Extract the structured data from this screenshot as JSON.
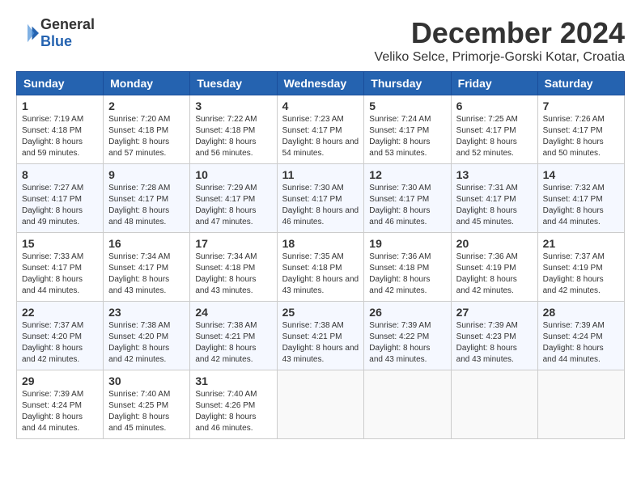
{
  "logo": {
    "general": "General",
    "blue": "Blue"
  },
  "title": "December 2024",
  "location": "Veliko Selce, Primorje-Gorski Kotar, Croatia",
  "days_of_week": [
    "Sunday",
    "Monday",
    "Tuesday",
    "Wednesday",
    "Thursday",
    "Friday",
    "Saturday"
  ],
  "weeks": [
    [
      {
        "day": "1",
        "sunrise": "7:19 AM",
        "sunset": "4:18 PM",
        "daylight": "8 hours and 59 minutes."
      },
      {
        "day": "2",
        "sunrise": "7:20 AM",
        "sunset": "4:18 PM",
        "daylight": "8 hours and 57 minutes."
      },
      {
        "day": "3",
        "sunrise": "7:22 AM",
        "sunset": "4:18 PM",
        "daylight": "8 hours and 56 minutes."
      },
      {
        "day": "4",
        "sunrise": "7:23 AM",
        "sunset": "4:17 PM",
        "daylight": "8 hours and 54 minutes."
      },
      {
        "day": "5",
        "sunrise": "7:24 AM",
        "sunset": "4:17 PM",
        "daylight": "8 hours and 53 minutes."
      },
      {
        "day": "6",
        "sunrise": "7:25 AM",
        "sunset": "4:17 PM",
        "daylight": "8 hours and 52 minutes."
      },
      {
        "day": "7",
        "sunrise": "7:26 AM",
        "sunset": "4:17 PM",
        "daylight": "8 hours and 50 minutes."
      }
    ],
    [
      {
        "day": "8",
        "sunrise": "7:27 AM",
        "sunset": "4:17 PM",
        "daylight": "8 hours and 49 minutes."
      },
      {
        "day": "9",
        "sunrise": "7:28 AM",
        "sunset": "4:17 PM",
        "daylight": "8 hours and 48 minutes."
      },
      {
        "day": "10",
        "sunrise": "7:29 AM",
        "sunset": "4:17 PM",
        "daylight": "8 hours and 47 minutes."
      },
      {
        "day": "11",
        "sunrise": "7:30 AM",
        "sunset": "4:17 PM",
        "daylight": "8 hours and 46 minutes."
      },
      {
        "day": "12",
        "sunrise": "7:30 AM",
        "sunset": "4:17 PM",
        "daylight": "8 hours and 46 minutes."
      },
      {
        "day": "13",
        "sunrise": "7:31 AM",
        "sunset": "4:17 PM",
        "daylight": "8 hours and 45 minutes."
      },
      {
        "day": "14",
        "sunrise": "7:32 AM",
        "sunset": "4:17 PM",
        "daylight": "8 hours and 44 minutes."
      }
    ],
    [
      {
        "day": "15",
        "sunrise": "7:33 AM",
        "sunset": "4:17 PM",
        "daylight": "8 hours and 44 minutes."
      },
      {
        "day": "16",
        "sunrise": "7:34 AM",
        "sunset": "4:17 PM",
        "daylight": "8 hours and 43 minutes."
      },
      {
        "day": "17",
        "sunrise": "7:34 AM",
        "sunset": "4:18 PM",
        "daylight": "8 hours and 43 minutes."
      },
      {
        "day": "18",
        "sunrise": "7:35 AM",
        "sunset": "4:18 PM",
        "daylight": "8 hours and 43 minutes."
      },
      {
        "day": "19",
        "sunrise": "7:36 AM",
        "sunset": "4:18 PM",
        "daylight": "8 hours and 42 minutes."
      },
      {
        "day": "20",
        "sunrise": "7:36 AM",
        "sunset": "4:19 PM",
        "daylight": "8 hours and 42 minutes."
      },
      {
        "day": "21",
        "sunrise": "7:37 AM",
        "sunset": "4:19 PM",
        "daylight": "8 hours and 42 minutes."
      }
    ],
    [
      {
        "day": "22",
        "sunrise": "7:37 AM",
        "sunset": "4:20 PM",
        "daylight": "8 hours and 42 minutes."
      },
      {
        "day": "23",
        "sunrise": "7:38 AM",
        "sunset": "4:20 PM",
        "daylight": "8 hours and 42 minutes."
      },
      {
        "day": "24",
        "sunrise": "7:38 AM",
        "sunset": "4:21 PM",
        "daylight": "8 hours and 42 minutes."
      },
      {
        "day": "25",
        "sunrise": "7:38 AM",
        "sunset": "4:21 PM",
        "daylight": "8 hours and 43 minutes."
      },
      {
        "day": "26",
        "sunrise": "7:39 AM",
        "sunset": "4:22 PM",
        "daylight": "8 hours and 43 minutes."
      },
      {
        "day": "27",
        "sunrise": "7:39 AM",
        "sunset": "4:23 PM",
        "daylight": "8 hours and 43 minutes."
      },
      {
        "day": "28",
        "sunrise": "7:39 AM",
        "sunset": "4:24 PM",
        "daylight": "8 hours and 44 minutes."
      }
    ],
    [
      {
        "day": "29",
        "sunrise": "7:39 AM",
        "sunset": "4:24 PM",
        "daylight": "8 hours and 44 minutes."
      },
      {
        "day": "30",
        "sunrise": "7:40 AM",
        "sunset": "4:25 PM",
        "daylight": "8 hours and 45 minutes."
      },
      {
        "day": "31",
        "sunrise": "7:40 AM",
        "sunset": "4:26 PM",
        "daylight": "8 hours and 46 minutes."
      },
      null,
      null,
      null,
      null
    ]
  ],
  "labels": {
    "sunrise": "Sunrise:",
    "sunset": "Sunset:",
    "daylight": "Daylight:"
  }
}
